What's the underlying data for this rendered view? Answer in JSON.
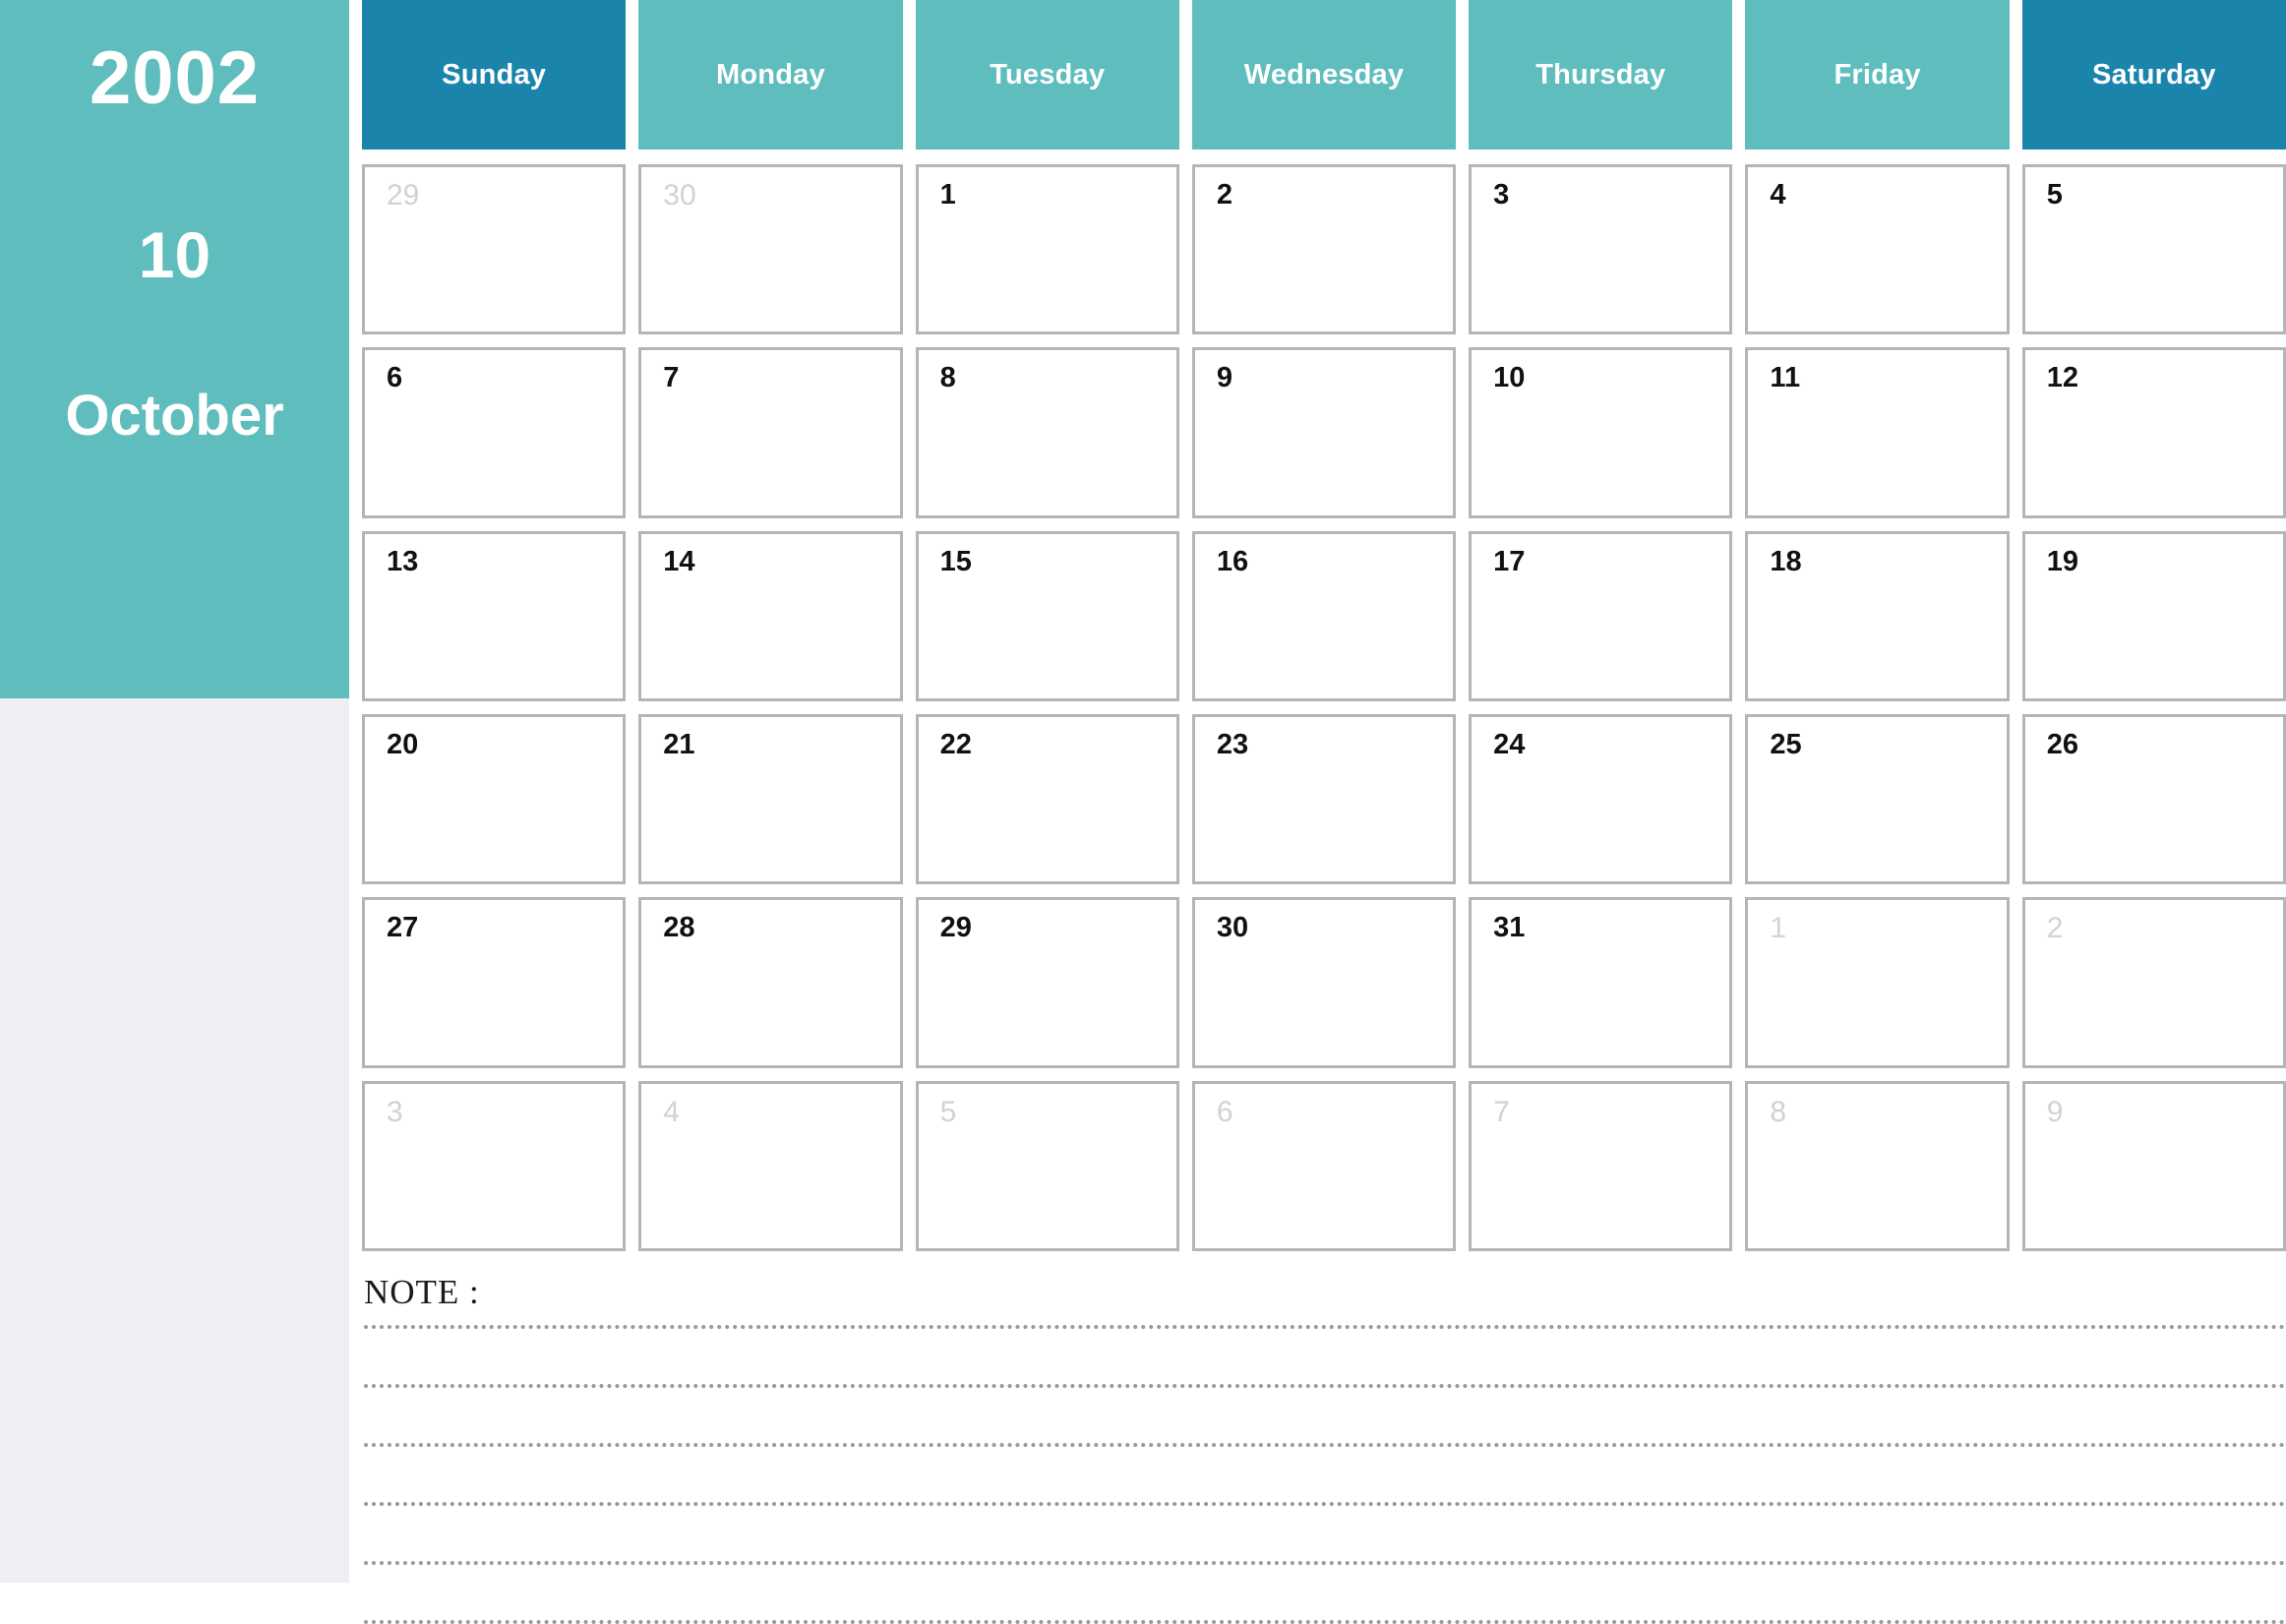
{
  "sidebar": {
    "year": "2002",
    "month_number": "10",
    "month_name": "October",
    "bg_color": "#5fbdbd",
    "page_bg_color": "#eeeef3"
  },
  "header": {
    "accent_weekend_color": "#1b84ab",
    "accent_weekday_color": "#5fbdbd",
    "weekdays": [
      {
        "label": "Sunday",
        "weekend": true
      },
      {
        "label": "Monday",
        "weekend": false
      },
      {
        "label": "Tuesday",
        "weekend": false
      },
      {
        "label": "Wednesday",
        "weekend": false
      },
      {
        "label": "Thursday",
        "weekend": false
      },
      {
        "label": "Friday",
        "weekend": false
      },
      {
        "label": "Saturday",
        "weekend": true
      }
    ]
  },
  "calendar": {
    "weeks": [
      [
        {
          "day": "29",
          "in_month": false
        },
        {
          "day": "30",
          "in_month": false
        },
        {
          "day": "1",
          "in_month": true
        },
        {
          "day": "2",
          "in_month": true
        },
        {
          "day": "3",
          "in_month": true
        },
        {
          "day": "4",
          "in_month": true
        },
        {
          "day": "5",
          "in_month": true
        }
      ],
      [
        {
          "day": "6",
          "in_month": true
        },
        {
          "day": "7",
          "in_month": true
        },
        {
          "day": "8",
          "in_month": true
        },
        {
          "day": "9",
          "in_month": true
        },
        {
          "day": "10",
          "in_month": true
        },
        {
          "day": "11",
          "in_month": true
        },
        {
          "day": "12",
          "in_month": true
        }
      ],
      [
        {
          "day": "13",
          "in_month": true
        },
        {
          "day": "14",
          "in_month": true
        },
        {
          "day": "15",
          "in_month": true
        },
        {
          "day": "16",
          "in_month": true
        },
        {
          "day": "17",
          "in_month": true
        },
        {
          "day": "18",
          "in_month": true
        },
        {
          "day": "19",
          "in_month": true
        }
      ],
      [
        {
          "day": "20",
          "in_month": true
        },
        {
          "day": "21",
          "in_month": true
        },
        {
          "day": "22",
          "in_month": true
        },
        {
          "day": "23",
          "in_month": true
        },
        {
          "day": "24",
          "in_month": true
        },
        {
          "day": "25",
          "in_month": true
        },
        {
          "day": "26",
          "in_month": true
        }
      ],
      [
        {
          "day": "27",
          "in_month": true
        },
        {
          "day": "28",
          "in_month": true
        },
        {
          "day": "29",
          "in_month": true
        },
        {
          "day": "30",
          "in_month": true
        },
        {
          "day": "31",
          "in_month": true
        },
        {
          "day": "1",
          "in_month": false
        },
        {
          "day": "2",
          "in_month": false
        }
      ],
      [
        {
          "day": "3",
          "in_month": false
        },
        {
          "day": "4",
          "in_month": false
        },
        {
          "day": "5",
          "in_month": false
        },
        {
          "day": "6",
          "in_month": false
        },
        {
          "day": "7",
          "in_month": false
        },
        {
          "day": "8",
          "in_month": false
        },
        {
          "day": "9",
          "in_month": false
        }
      ]
    ]
  },
  "note": {
    "label": "NOTE :",
    "line_count": 6
  }
}
